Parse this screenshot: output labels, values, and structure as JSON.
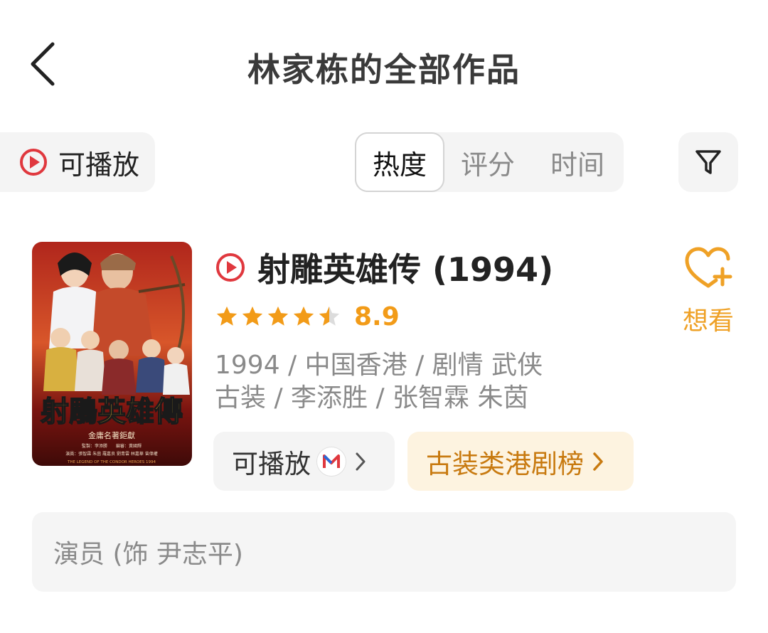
{
  "header": {
    "title": "林家栋的全部作品",
    "back_icon": "chevron-left-icon"
  },
  "filters": {
    "playable_label": "可播放",
    "sort_tabs": [
      {
        "label": "热度",
        "active": true
      },
      {
        "label": "评分",
        "active": false
      },
      {
        "label": "时间",
        "active": false
      }
    ],
    "filter_icon": "funnel-icon"
  },
  "item": {
    "poster": {
      "title_art": "射鵰英雄傳",
      "subtitle_art": "金庸名著鉅獻",
      "credit_line1": "監製：李添勝　　編審：黃國輝",
      "credit_line2": "演員：張智霖 朱茵 羅嘉良 劉青雲 林嘉華 曾偉權",
      "english_art": "THE LEGEND OF THE CONDOR HEROES 1994"
    },
    "title": "射雕英雄传 (1994)",
    "rating": {
      "stars": 4.5,
      "value": "8.9"
    },
    "meta_line1": "1994 / 中国香港 / 剧情 武侠",
    "meta_line2": "古装 / 李添胜 / 张智霖 朱茵",
    "play_button": {
      "label": "可播放",
      "platform_icon": "mango-tv-icon"
    },
    "rank_button": {
      "label": "古装类港剧榜"
    },
    "want_button": {
      "label": "想看"
    },
    "role": "演员 (饰 尹志平)"
  },
  "colors": {
    "red": "#e0383e",
    "orange": "#f29b18",
    "chip_bg": "#f4f4f4"
  }
}
